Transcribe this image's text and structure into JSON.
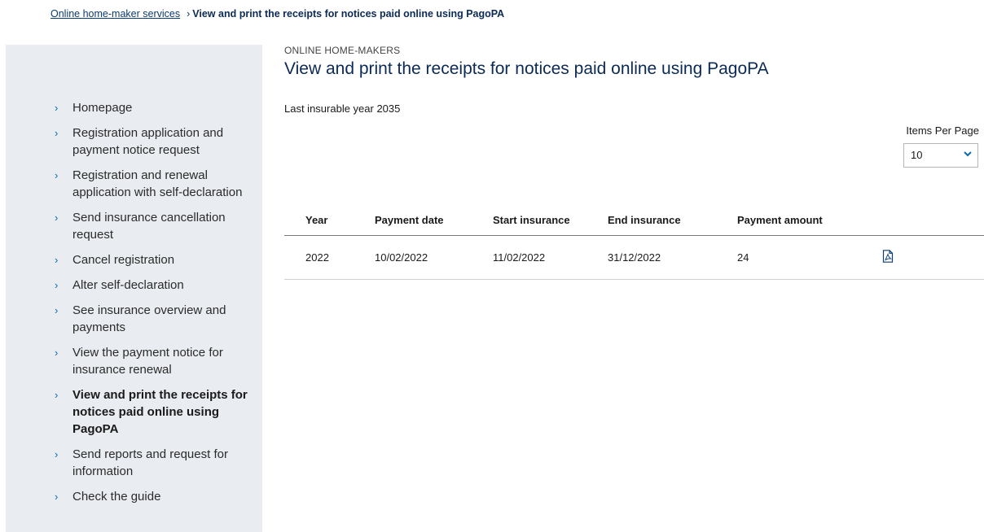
{
  "breadcrumb": {
    "home_link": "Online home-maker services",
    "separator": "›",
    "current": "View and print the receipts for notices paid online using PagoPA"
  },
  "sidebar": {
    "items": [
      {
        "label": "Homepage",
        "active": false
      },
      {
        "label": "Registration application and payment notice request",
        "active": false
      },
      {
        "label": "Registration and renewal application with self-declaration",
        "active": false
      },
      {
        "label": "Send insurance cancellation request",
        "active": false
      },
      {
        "label": "Cancel registration",
        "active": false
      },
      {
        "label": "Alter self-declaration",
        "active": false
      },
      {
        "label": "See insurance overview and payments",
        "active": false
      },
      {
        "label": "View the payment notice for insurance renewal",
        "active": false
      },
      {
        "label": "View and print the receipts for notices paid online using PagoPA",
        "active": true
      },
      {
        "label": "Send reports and request for information",
        "active": false
      },
      {
        "label": "Check the guide",
        "active": false
      }
    ],
    "chevron": "›"
  },
  "main": {
    "section_label": "ONLINE HOME-MAKERS",
    "title": "View and print the receipts for notices paid online using PagoPA",
    "last_year": "Last insurable year 2035",
    "items_per_page": {
      "label": "Items Per Page",
      "value": "10"
    },
    "table": {
      "headers": [
        "Year",
        "Payment date",
        "Start insurance",
        "End insurance",
        "Payment amount",
        ""
      ],
      "rows": [
        {
          "year": "2022",
          "payment_date": "10/02/2022",
          "start": "11/02/2022",
          "end": "31/12/2022",
          "amount": "24",
          "action_icon": "pdf-icon"
        }
      ]
    }
  },
  "colors": {
    "sidebar_bg": "#e9ecf0",
    "title": "#0b2a55",
    "link": "#0b3b73",
    "chevron": "#0b6ab0"
  }
}
